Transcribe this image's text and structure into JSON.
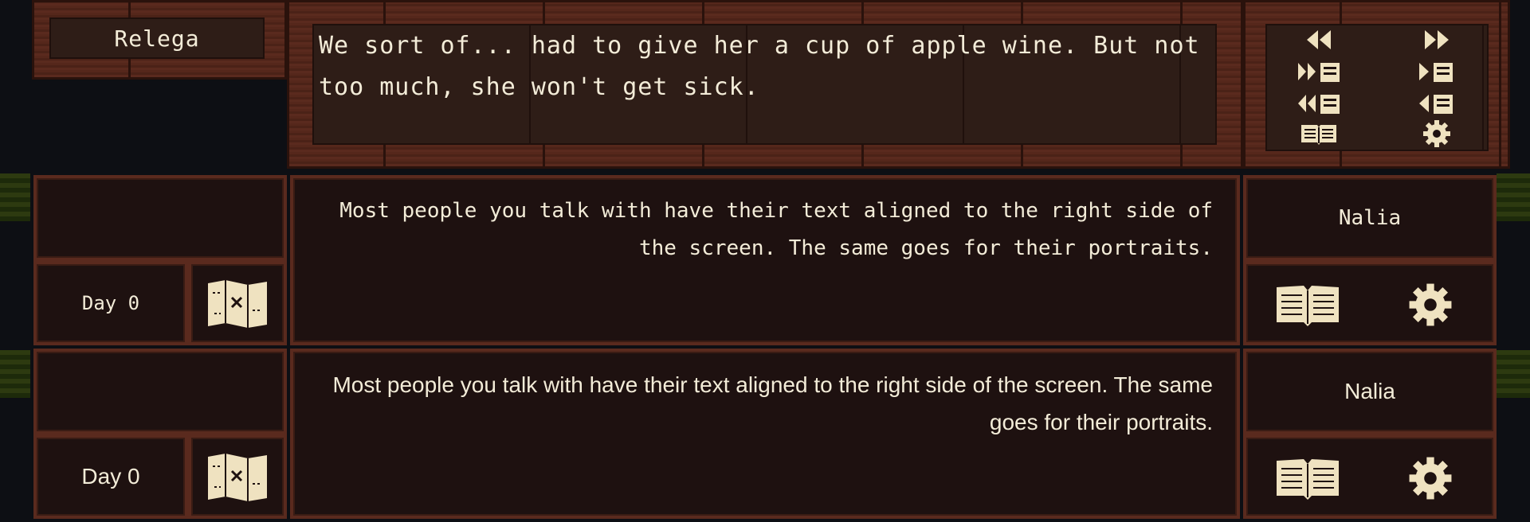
{
  "speaker": {
    "name": "Relega"
  },
  "dialog": {
    "text": "We sort of... had to give her a cup of apple wine. But not too much, she won't get sick."
  },
  "controls": {
    "rewind": "⏪",
    "forward": "⏩",
    "skip_save": "⏩▤",
    "save": "▶▤",
    "back_save": "⏪▤",
    "load": "◀▤",
    "log": "📖",
    "settings": "⚙"
  },
  "preview_pixel": {
    "day_label": "Day 0",
    "message": "Most people you talk with have their text aligned to the right side of the screen. The same goes for their portraits.",
    "speaker": "Nalia"
  },
  "preview_sans": {
    "day_label": "Day 0",
    "message": "Most people you talk with have their text aligned to the right side of the screen. The same goes for their portraits.",
    "speaker": "Nalia"
  },
  "colors": {
    "wood": "#5a2a1e",
    "panel": "#1e1110",
    "text": "#f3ecd8",
    "icon": "#efe2c0"
  }
}
